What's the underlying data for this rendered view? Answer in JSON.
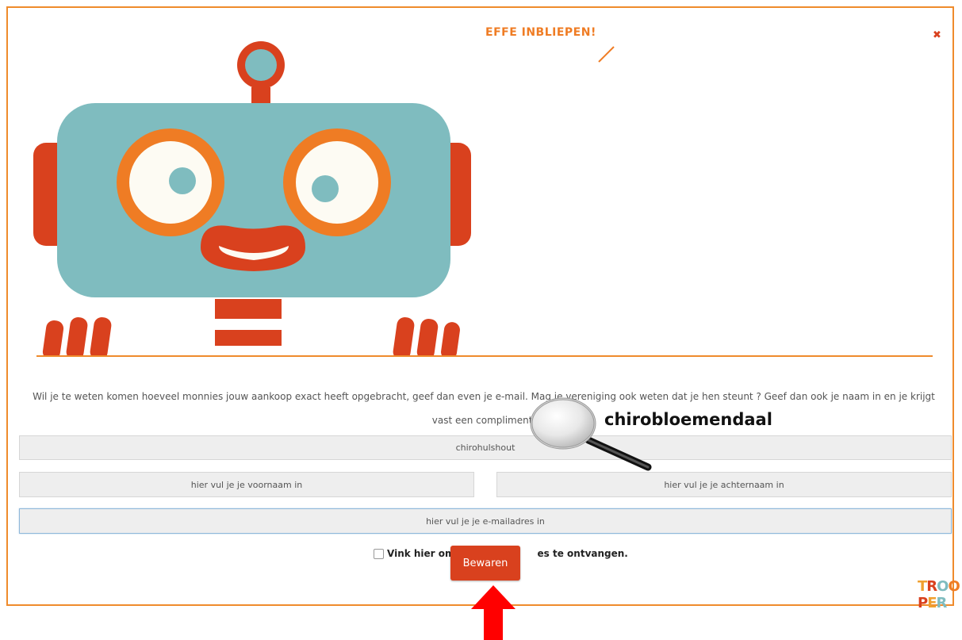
{
  "popup": {
    "title": "EFFE INBLIEPEN!",
    "close_glyph": "✖",
    "intro_text": "Wil je te weten komen hoeveel monnies jouw aankoop exact heeft opgebracht, geef dan even je e-mail. Mag je vereniging ook weten dat je hen steunt ? Geef dan ook je naam in en je krijgt vast een compliment."
  },
  "form": {
    "organization_value": "chirohulshout",
    "firstname_placeholder": "hier vul je je voornaam in",
    "lastname_placeholder": "hier vul je je achternaam in",
    "email_placeholder": "hier vul je je e-mailadres in",
    "checkbox_label_start": "Vink hier om",
    "checkbox_label_end": "es te ontvangen.",
    "save_label": "Bewaren"
  },
  "annotation": {
    "search_term": "chirobloemendaal"
  },
  "brand": {
    "logo_letters": [
      "T",
      "R",
      "O",
      "O",
      "P",
      "E",
      "R"
    ],
    "logo_colors": [
      "#f0a030",
      "#d9411e",
      "#7fbcbf",
      "#ef7c24",
      "#d9411e",
      "#f0a030",
      "#7fbcbf"
    ]
  },
  "colors": {
    "accent_orange": "#ef8b2c",
    "button_red": "#d9411e",
    "robot_teal": "#7fbcbf"
  },
  "icons": {
    "close": "close-icon",
    "magnifier": "magnifier-icon",
    "arrow": "up-arrow-icon"
  }
}
